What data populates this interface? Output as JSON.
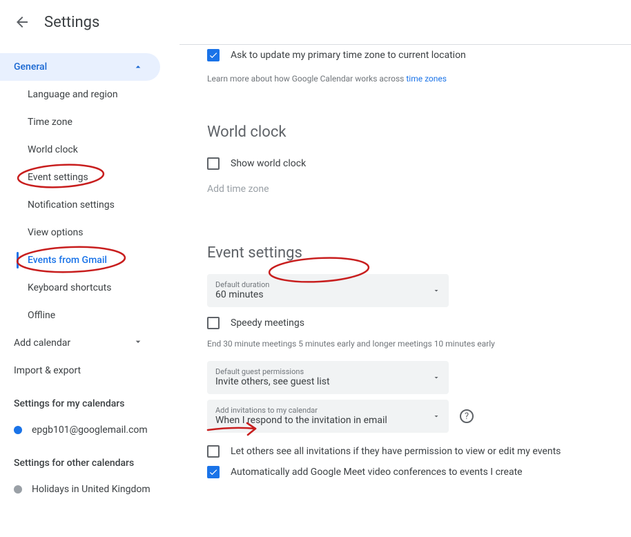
{
  "header": {
    "title": "Settings"
  },
  "sidebar": {
    "general_label": "General",
    "items": [
      "Language and region",
      "Time zone",
      "World clock",
      "Event settings",
      "Notification settings",
      "View options",
      "Events from Gmail",
      "Keyboard shortcuts",
      "Offline"
    ],
    "selected_index": 6,
    "add_calendar_label": "Add calendar",
    "import_export_label": "Import & export",
    "my_cal_label": "Settings for my calendars",
    "my_calendars": [
      {
        "name": "epgb101@googlemail.com",
        "color": "#1a73e8"
      }
    ],
    "other_cal_label": "Settings for other calendars",
    "other_calendars": [
      {
        "name": "Holidays in United Kingdom",
        "color": "#9aa0a6"
      }
    ]
  },
  "main": {
    "tz_checkbox": {
      "checked": true,
      "label": "Ask to update my primary time zone to current location"
    },
    "tz_helper_prefix": "Learn more about how Google Calendar works across ",
    "tz_helper_link": "time zones",
    "world_clock": {
      "title": "World clock",
      "show_label": "Show world clock",
      "show_checked": false,
      "add_tz_label": "Add time zone"
    },
    "event_settings": {
      "title": "Event settings",
      "default_duration": {
        "label": "Default duration",
        "value": "60 minutes"
      },
      "speedy": {
        "label": "Speedy meetings",
        "checked": false
      },
      "speedy_hint": "End 30 minute meetings 5 minutes early and longer meetings 10 minutes early",
      "guest_perm": {
        "label": "Default guest permissions",
        "value": "Invite others, see guest list"
      },
      "invitations": {
        "label": "Add invitations to my calendar",
        "value": "When I respond to the invitation in email"
      },
      "let_others": {
        "label": "Let others see all invitations if they have permission to view or edit my events",
        "checked": false
      },
      "auto_meet": {
        "label": "Automatically add Google Meet video conferences to events I create",
        "checked": true
      }
    }
  }
}
